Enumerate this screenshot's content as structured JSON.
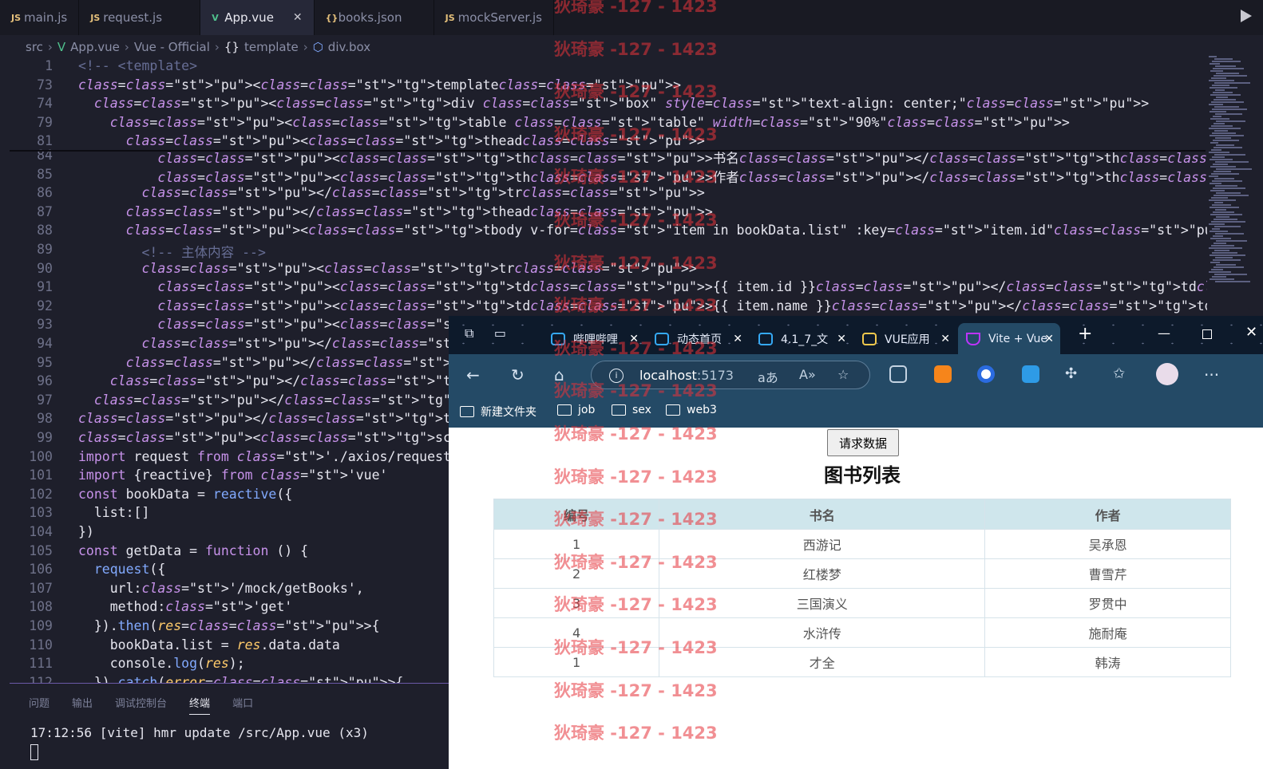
{
  "editor": {
    "tabs": [
      {
        "icon": "JS",
        "label": "main.js"
      },
      {
        "icon": "JS",
        "label": "request.js"
      },
      {
        "icon": "V",
        "label": "App.vue",
        "close": "✕"
      },
      {
        "icon": "{}",
        "label": "books.json"
      },
      {
        "icon": "JS",
        "label": "mockServer.js"
      }
    ],
    "breadcrumb": [
      "src",
      "App.vue",
      "Vue - Official",
      "template",
      "div.box"
    ],
    "lines": [
      {
        "n": "1",
        "code": "<!-- <template>"
      },
      {
        "n": "73",
        "code": "<template>"
      },
      {
        "n": "74",
        "code": "  <div class=\"box\" style=\"text-align: center;\">"
      },
      {
        "n": "79",
        "code": "    <table class=\"table\" width=\"90%\">"
      },
      {
        "n": "81",
        "code": "      <thead>"
      },
      {
        "n": "84",
        "code": "          <th>书名</th>"
      },
      {
        "n": "85",
        "code": "          <th>作者</th>"
      },
      {
        "n": "86",
        "code": "        </tr>"
      },
      {
        "n": "87",
        "code": "      </thead>"
      },
      {
        "n": "88",
        "code": "      <tbody v-for=\"item in bookData.list\" :key=\"item.id\">"
      },
      {
        "n": "89",
        "code": "        <!-- 主体内容 -->"
      },
      {
        "n": "90",
        "code": "        <tr>"
      },
      {
        "n": "91",
        "code": "          <td>{{ item.id }}</td>"
      },
      {
        "n": "92",
        "code": "          <td>{{ item.name }}</td>"
      },
      {
        "n": "93",
        "code": "          <td>{{ item.author }}</td>"
      },
      {
        "n": "94",
        "code": "        </tr>"
      },
      {
        "n": "95",
        "code": "      </tbody>"
      },
      {
        "n": "96",
        "code": "    </table>"
      },
      {
        "n": "97",
        "code": "  </div>"
      },
      {
        "n": "98",
        "code": "</template>"
      },
      {
        "n": "99",
        "code": "<script setup>"
      },
      {
        "n": "100",
        "code": "import request from './axios/request';"
      },
      {
        "n": "101",
        "code": "import {reactive} from 'vue'"
      },
      {
        "n": "102",
        "code": "const bookData = reactive({"
      },
      {
        "n": "103",
        "code": "  list:[]"
      },
      {
        "n": "104",
        "code": "})"
      },
      {
        "n": "105",
        "code": "const getData = function () {"
      },
      {
        "n": "106",
        "code": "  request({"
      },
      {
        "n": "107",
        "code": "    url:'/mock/getBooks',"
      },
      {
        "n": "108",
        "code": "    method:'get'"
      },
      {
        "n": "109",
        "code": "  }).then(res=>{"
      },
      {
        "n": "110",
        "code": "    bookData.list = res.data.data"
      },
      {
        "n": "111",
        "code": "    console.log(res);"
      },
      {
        "n": "112",
        "code": "  }).catch(error=>{"
      }
    ]
  },
  "panel": {
    "tabs": [
      "问题",
      "输出",
      "调试控制台",
      "终端",
      "端口"
    ],
    "active_tab": "终端",
    "terminal_line": "17:12:56 [vite] hmr update /src/App.vue (x3)"
  },
  "browser": {
    "tabs": [
      {
        "label": "哔哩哔哩",
        "close": "✕"
      },
      {
        "label": "动态首页",
        "close": "✕"
      },
      {
        "label": "4.1_7_文",
        "close": "✕"
      },
      {
        "label": "VUE应用",
        "close": "✕"
      },
      {
        "label": "Vite + Vue",
        "close": "✕"
      }
    ],
    "new_tab": "+",
    "url_host": "localhost",
    "url_port": ":5173",
    "bookmarks": [
      "新建文件夹",
      "job",
      "sex",
      "web3"
    ],
    "page": {
      "button": "请求数据",
      "title": "图书列表",
      "headers": [
        "编号",
        "书名",
        "作者"
      ],
      "rows": [
        [
          "1",
          "西游记",
          "吴承恩"
        ],
        [
          "2",
          "红楼梦",
          "曹雪芹"
        ],
        [
          "3",
          "三国演义",
          "罗贯中"
        ],
        [
          "4",
          "水浒传",
          "施耐庵"
        ],
        [
          "1",
          "才全",
          "韩涛"
        ]
      ]
    }
  },
  "watermark": "狄琦豪 -127 - 1423",
  "colors": {
    "accent": "#6b5aa8",
    "vue_green": "#4fc08d",
    "browser_chrome": "#244a66",
    "watermark": "#e7343b"
  }
}
